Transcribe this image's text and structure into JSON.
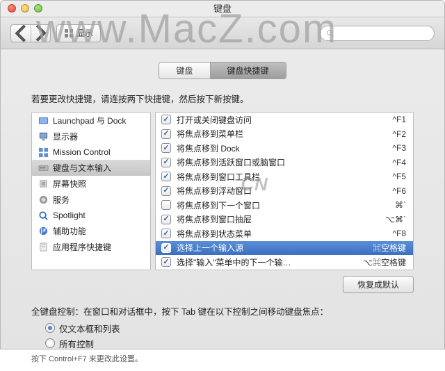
{
  "watermark_main": "www.MacZ.com",
  "watermark_cn": ".CN",
  "window": {
    "title": "键盘"
  },
  "toolbar": {
    "show_all": "显示"
  },
  "tabs": {
    "keyboard": "键盘",
    "shortcuts": "键盘快捷键"
  },
  "instruction": "若要更改快捷键，请连按两下快捷键，然后按下新按键。",
  "sidebar": {
    "items": [
      {
        "label": "Launchpad 与 Dock"
      },
      {
        "label": "显示器"
      },
      {
        "label": "Mission Control"
      },
      {
        "label": "键盘与文本输入"
      },
      {
        "label": "屏幕快照"
      },
      {
        "label": "服务"
      },
      {
        "label": "Spotlight"
      },
      {
        "label": "辅助功能"
      },
      {
        "label": "应用程序快捷键"
      }
    ],
    "selected_index": 3
  },
  "shortcuts": [
    {
      "checked": true,
      "label": "打开或关闭键盘访问",
      "key": "^F1"
    },
    {
      "checked": true,
      "label": "将焦点移到菜单栏",
      "key": "^F2"
    },
    {
      "checked": true,
      "label": "将焦点移到 Dock",
      "key": "^F3"
    },
    {
      "checked": true,
      "label": "将焦点移到活跃窗口或脑窗口",
      "key": "^F4"
    },
    {
      "checked": true,
      "label": "将焦点移到窗口工具栏",
      "key": "^F5"
    },
    {
      "checked": true,
      "label": "将焦点移到浮动窗口",
      "key": "^F6"
    },
    {
      "checked": false,
      "label": "将焦点移到下一个窗口",
      "key": "⌘`"
    },
    {
      "checked": true,
      "label": "将焦点移到窗口抽屉",
      "key": "⌥⌘`"
    },
    {
      "checked": true,
      "label": "将焦点移到状态菜单",
      "key": "^F8"
    },
    {
      "checked": true,
      "label": "选择上一个输入源",
      "key": "⌘空格键"
    },
    {
      "checked": true,
      "label": "选择\"输入\"菜单中的下一个输…",
      "key": "⌥⌘空格键"
    }
  ],
  "shortcuts_selected_index": 9,
  "restore_defaults": "恢复成默认",
  "full_keyboard": {
    "intro": "全键盘控制：在窗口和对话框中，按下 Tab 键在以下控制之间移动键盘焦点：",
    "option_text_only": "仅文本框和列表",
    "option_all": "所有控制",
    "selected": 0,
    "note": "按下 Control+F7 来更改此设置。"
  }
}
